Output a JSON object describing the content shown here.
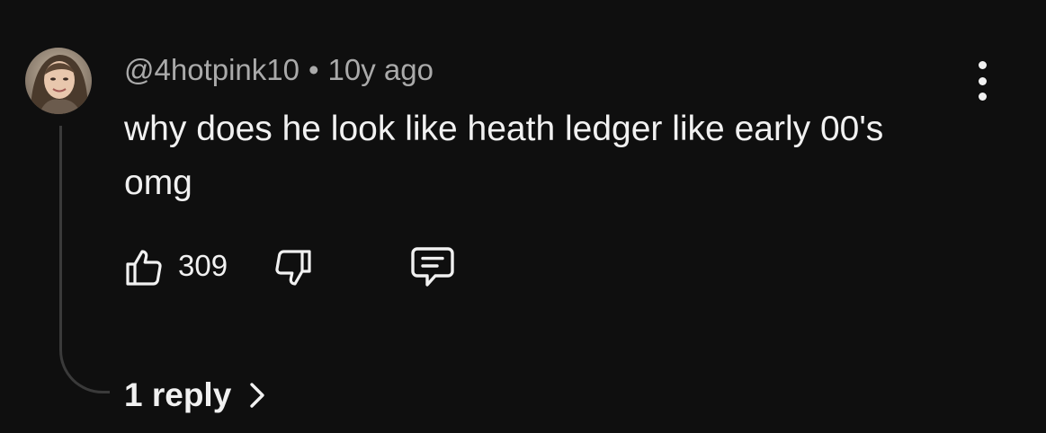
{
  "comment": {
    "username": "@4hotpink10",
    "separator": "•",
    "timestamp": "10y ago",
    "text": "why does he look like heath ledger like early 00's omg",
    "like_count": "309",
    "replies_label": "1 reply"
  },
  "icons": {
    "avatar": "profile-photo",
    "more": "more-vertical-icon",
    "like": "thumbs-up-icon",
    "dislike": "thumbs-down-icon",
    "reply": "comment-icon",
    "chevron": "chevron-right-icon"
  },
  "colors": {
    "background": "#0f0f0f",
    "text": "#f1f1f1",
    "secondary_text": "#aaaaaa",
    "thread_line": "#3a3a3a"
  }
}
